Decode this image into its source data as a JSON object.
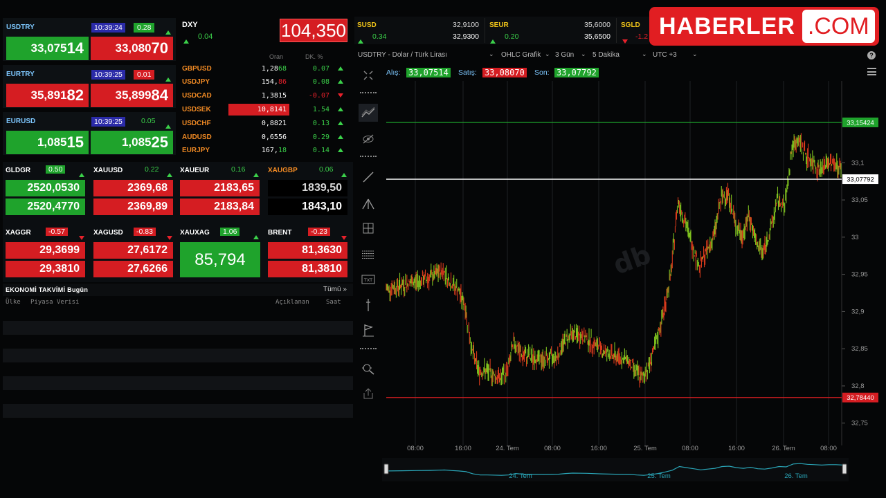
{
  "fx": [
    {
      "name": "USDTRY",
      "time": "10:39:24",
      "change": "0.28",
      "change_dir": "up",
      "bid_main": "33,075",
      "bid_tail": "14",
      "ask_main": "33,080",
      "ask_tail": "70",
      "bid_color": "green",
      "ask_color": "red"
    },
    {
      "name": "EURTRY",
      "time": "10:39:25",
      "change": "0.01",
      "change_dir": "up",
      "bid_main": "35,891",
      "bid_tail": "82",
      "ask_main": "35,899",
      "ask_tail": "84",
      "bid_color": "red",
      "ask_color": "red"
    },
    {
      "name": "EURUSD",
      "time": "10:39:25",
      "change": "0.05",
      "change_dir": "up",
      "bid_main": "1,085",
      "bid_tail": "15",
      "ask_main": "1,085",
      "ask_tail": "25",
      "bid_color": "green",
      "ask_color": "green"
    }
  ],
  "dxy": {
    "name": "DXY",
    "change": "0.04",
    "value": "104,350",
    "col_rate": "Oran",
    "col_pct": "DK. %"
  },
  "dxy_rows": [
    {
      "sym": "GBPUSD",
      "val_a": "1,28",
      "val_b": "68",
      "pct": "0.07",
      "dir": "up",
      "hl": false
    },
    {
      "sym": "USDJPY",
      "val_a": "154,",
      "val_b": "86",
      "pct": "0.08",
      "dir": "up",
      "hl": false
    },
    {
      "sym": "USDCAD",
      "val_a": "1,3815",
      "val_b": "",
      "pct": "-0.07",
      "dir": "down",
      "hl": false
    },
    {
      "sym": "USDSEK",
      "val_a": "10,8141",
      "val_b": "",
      "pct": "1.54",
      "dir": "up",
      "hl": true
    },
    {
      "sym": "USDCHF",
      "val_a": "0,8821",
      "val_b": "",
      "pct": "0.13",
      "dir": "up",
      "hl": false
    },
    {
      "sym": "AUDUSD",
      "val_a": "0,6556",
      "val_b": "",
      "pct": "0.29",
      "dir": "up",
      "hl": false
    },
    {
      "sym": "EURJPY",
      "val_a": "167,",
      "val_b": "18",
      "pct": "0.14",
      "dir": "up",
      "hl": false
    }
  ],
  "metals1": [
    {
      "name": "GLDGR",
      "change": "0.50",
      "boxed": true,
      "bid": "2520,0530",
      "ask": "2520,4770",
      "color": "green"
    },
    {
      "name": "XAUUSD",
      "change": "0.22",
      "boxed": false,
      "bid": "2369,68",
      "ask": "2369,89",
      "color": "red"
    },
    {
      "name": "XAUEUR",
      "change": "0.16",
      "boxed": false,
      "bid": "2183,65",
      "ask": "2183,84",
      "color": "red"
    },
    {
      "name": "XAUGBP",
      "change": "0.06",
      "boxed": false,
      "bid": "1839,50",
      "ask": "1843,10",
      "color": "dark"
    }
  ],
  "metals2": [
    {
      "name": "XAGGR",
      "change": "-0.57",
      "bid": "29,3699",
      "ask": "29,3810"
    },
    {
      "name": "XAGUSD",
      "change": "-0.83",
      "bid": "27,6172",
      "ask": "27,6266"
    },
    {
      "name": "BRENT",
      "change": "-0.23",
      "bid": "81,3630",
      "ask": "81,3810"
    }
  ],
  "xauxag": {
    "name": "XAUXAG",
    "change": "1.06",
    "value": "85,794"
  },
  "econ": {
    "title": "EKONOMİ TAKVİMİ",
    "title_sub": "Bugün",
    "all": "Tümü »",
    "col_country": "Ülke",
    "col_data": "Piyasa Verisi",
    "col_announced": "Açıklanan",
    "col_time": "Saat"
  },
  "top_right": [
    {
      "name": "SUSD",
      "change": "0.34",
      "val1": "32,9100",
      "val2": "32,9300"
    },
    {
      "name": "SEUR",
      "change": "0.20",
      "val1": "35,6000",
      "val2": "35,6500"
    },
    {
      "name": "SGLD",
      "change": "-1.2"
    }
  ],
  "logo": {
    "part1": "HABERLER",
    "part2": ".COM"
  },
  "chart_toolbar": {
    "symbol": "USDTRY - Dolar / Türk Lirası",
    "chart_type": "OHLC Grafik",
    "range": "3 Gün",
    "interval": "5 Dakika",
    "timezone": "UTC +3"
  },
  "quotes": {
    "bid_label": "Alış:",
    "bid": "33,07514",
    "ask_label": "Satış:",
    "ask": "33,08070",
    "last_label": "Son:",
    "last": "33,07792"
  },
  "colors": {
    "green": "#1fa32c",
    "red": "#d51d22",
    "accent_blue": "#7ec8ff",
    "orange": "#f08a24"
  },
  "chart_data": {
    "type": "line",
    "ylabels": [
      "33,1",
      "33,05",
      "33",
      "32,95",
      "32,9",
      "32,85",
      "32,8",
      "32,75"
    ],
    "yvalues": [
      33.1,
      33.05,
      33.0,
      32.95,
      32.9,
      32.85,
      32.8,
      32.75
    ],
    "ylim": [
      32.72,
      33.21
    ],
    "xlabels": [
      "08:00",
      "16:00",
      "24. Tem",
      "08:00",
      "16:00",
      "25. Tem",
      "08:00",
      "16:00",
      "26. Tem",
      "08:00"
    ],
    "hlines": [
      {
        "label": "33,15424",
        "value": 33.15424,
        "color": "#1fa32c"
      },
      {
        "label": "33,07792",
        "value": 33.07792,
        "color": "#ffffff"
      },
      {
        "label": "32,78440",
        "value": 32.7844,
        "color": "#d51d22"
      }
    ],
    "series_points": [
      [
        0,
        32.93
      ],
      [
        2,
        32.935
      ],
      [
        4,
        32.94
      ],
      [
        6,
        32.945
      ],
      [
        8,
        32.955
      ],
      [
        9,
        32.94
      ],
      [
        10,
        32.93
      ],
      [
        11,
        32.91
      ],
      [
        12,
        32.85
      ],
      [
        13,
        32.82
      ],
      [
        14,
        32.82
      ],
      [
        16,
        32.81
      ],
      [
        17,
        32.82
      ],
      [
        18,
        32.86
      ],
      [
        19,
        32.84
      ],
      [
        20,
        32.84
      ],
      [
        22,
        32.835
      ],
      [
        24,
        32.84
      ],
      [
        25,
        32.86
      ],
      [
        26,
        32.87
      ],
      [
        28,
        32.865
      ],
      [
        30,
        32.85
      ],
      [
        32,
        32.84
      ],
      [
        34,
        32.835
      ],
      [
        35,
        32.82
      ],
      [
        36,
        32.81
      ],
      [
        37,
        32.83
      ],
      [
        38,
        32.86
      ],
      [
        39,
        32.9
      ],
      [
        40,
        32.95
      ],
      [
        41,
        33.05
      ],
      [
        42,
        33.02
      ],
      [
        43,
        32.99
      ],
      [
        44,
        32.96
      ],
      [
        45,
        32.98
      ],
      [
        46,
        33.0
      ],
      [
        47,
        33.05
      ],
      [
        48,
        33.06
      ],
      [
        49,
        33.02
      ],
      [
        50,
        33.0
      ],
      [
        51,
        33.03
      ],
      [
        52,
        32.99
      ],
      [
        53,
        32.98
      ],
      [
        54,
        33.01
      ],
      [
        55,
        33.05
      ],
      [
        56,
        33.04
      ],
      [
        57,
        33.12
      ],
      [
        58,
        33.13
      ],
      [
        59,
        33.11
      ],
      [
        60,
        33.1
      ],
      [
        61,
        33.09
      ],
      [
        62,
        33.1
      ],
      [
        63,
        33.1
      ],
      [
        64,
        33.09
      ]
    ]
  }
}
